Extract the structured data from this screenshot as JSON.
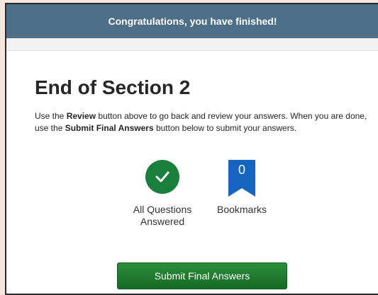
{
  "header": {
    "banner": "Congratulations, you have finished!"
  },
  "main": {
    "title": "End of Section 2",
    "instructions": {
      "part1": "Use the ",
      "review_bold": "Review",
      "part2": " button above to go back and review your answers. When you are done, use the ",
      "submit_bold": "Submit Final Answers",
      "part3": " button below to submit your answers."
    },
    "status": {
      "answered_icon": "check-icon",
      "answered_line1": "All Questions",
      "answered_line2": "Answered",
      "bookmark_icon": "bookmark-icon",
      "bookmark_count": "0",
      "bookmarks_label": "Bookmarks"
    },
    "submit_label": "Submit Final Answers"
  },
  "colors": {
    "header_bg": "#4c6e86",
    "success_green": "#1a7f3c",
    "bookmark_blue": "#1565c0",
    "button_green": "#1e7f2e"
  }
}
